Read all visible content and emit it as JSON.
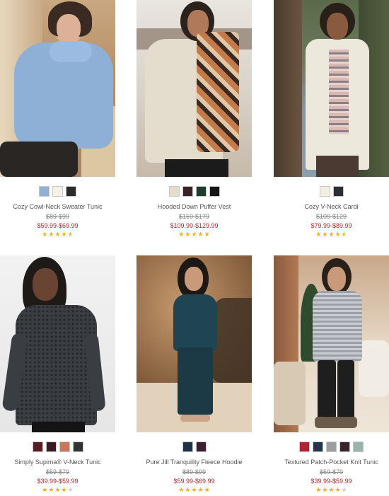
{
  "products": [
    {
      "name": "Cozy Cowl-Neck Sweater Tunic",
      "original_price": "$89-$99",
      "sale_price": "$59.99-$69.99",
      "rating": 4.5,
      "photo_icon": "product-photo-woman-blue-cowl-neck-tunic",
      "swatches": [
        "#93afd3",
        "#f4f2e6",
        "#2b2b2b"
      ]
    },
    {
      "name": "Hooded Down Puffer Vest",
      "original_price": "$159-$179",
      "sale_price": "$109.99-$129.99",
      "rating": 5,
      "photo_icon": "product-photo-woman-beige-puffer-vest",
      "swatches": [
        "#e5dccb",
        "#3b2227",
        "#1f3b2d",
        "#141414"
      ]
    },
    {
      "name": "Cozy V-Neck Cardi",
      "original_price": "$109-$129",
      "sale_price": "$79.99-$89.99",
      "rating": 4.5,
      "photo_icon": "product-photo-woman-ivory-cardigan",
      "swatches": [
        "#f3f0e2",
        "#2b2f33"
      ]
    },
    {
      "name": "Simply Supima® V-Neck Tunic",
      "original_price": "$59-$79",
      "sale_price": "$39.99-$59.99",
      "rating": 4,
      "photo_icon": "product-photo-woman-black-print-tunic",
      "swatches": [
        "#5a1b24",
        "#3a1b24",
        "#c8775a",
        "#333333"
      ]
    },
    {
      "name": "Pure Jill Tranquility Fleece Hoodie",
      "original_price": "$89-$99",
      "sale_price": "$59.99-$69.99",
      "rating": 5,
      "photo_icon": "product-photo-woman-teal-fleece-hoodie",
      "swatches": [
        "#1f3146",
        "#3a1f2c"
      ]
    },
    {
      "name": "Textured Patch-Pocket Knit Tunic",
      "original_price": "$59-$79",
      "sale_price": "$39.99-$59.99",
      "rating": 4,
      "photo_icon": "product-photo-woman-gray-striped-tunic",
      "swatches": [
        "#b0213a",
        "#23354b",
        "#9d9d9d",
        "#3c232b",
        "#9ab4a8"
      ]
    }
  ],
  "colors": {
    "sale_price": "#b3262f",
    "star_fill": "#f2b31b",
    "star_empty": "#cfcfcf"
  }
}
